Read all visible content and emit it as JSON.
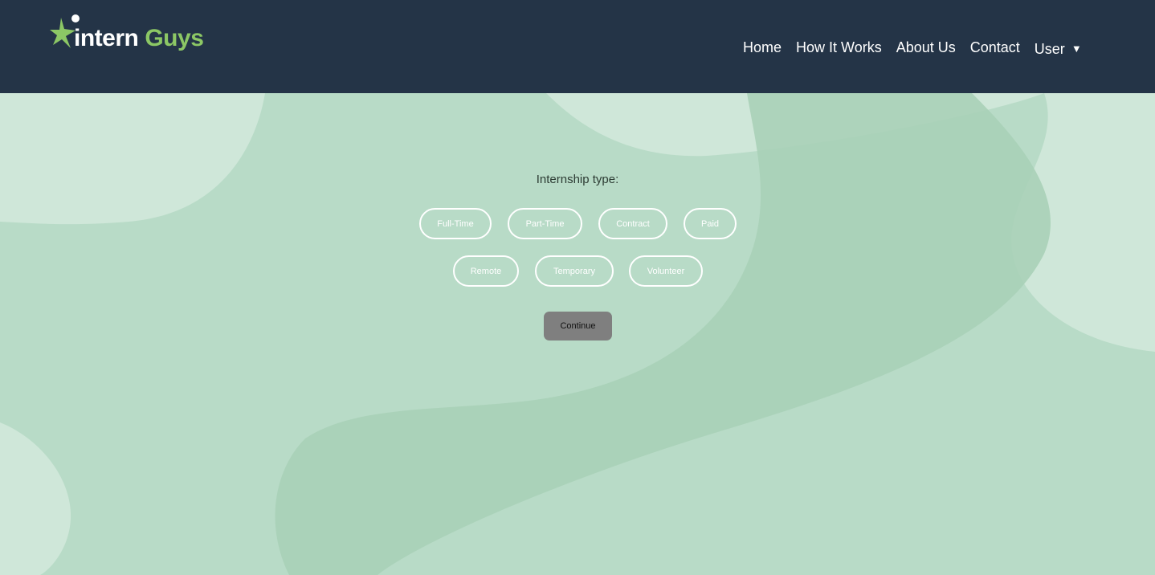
{
  "brand": {
    "word1": "intern",
    "word2": "Guys"
  },
  "nav": {
    "home": "Home",
    "how_it_works": "How It Works",
    "about_us": "About Us",
    "contact": "Contact",
    "user": "User",
    "user_caret": "▼"
  },
  "form": {
    "question": "Internship type:",
    "options": [
      "Full-Time",
      "Part-Time",
      "Contract",
      "Paid",
      "Remote",
      "Temporary",
      "Volunteer"
    ],
    "continue_label": "Continue"
  },
  "colors": {
    "header_bg": "#243447",
    "brand_accent": "#8cc765",
    "page_bg": "#b8dbc7",
    "continue_bg": "#7f7f7f"
  }
}
